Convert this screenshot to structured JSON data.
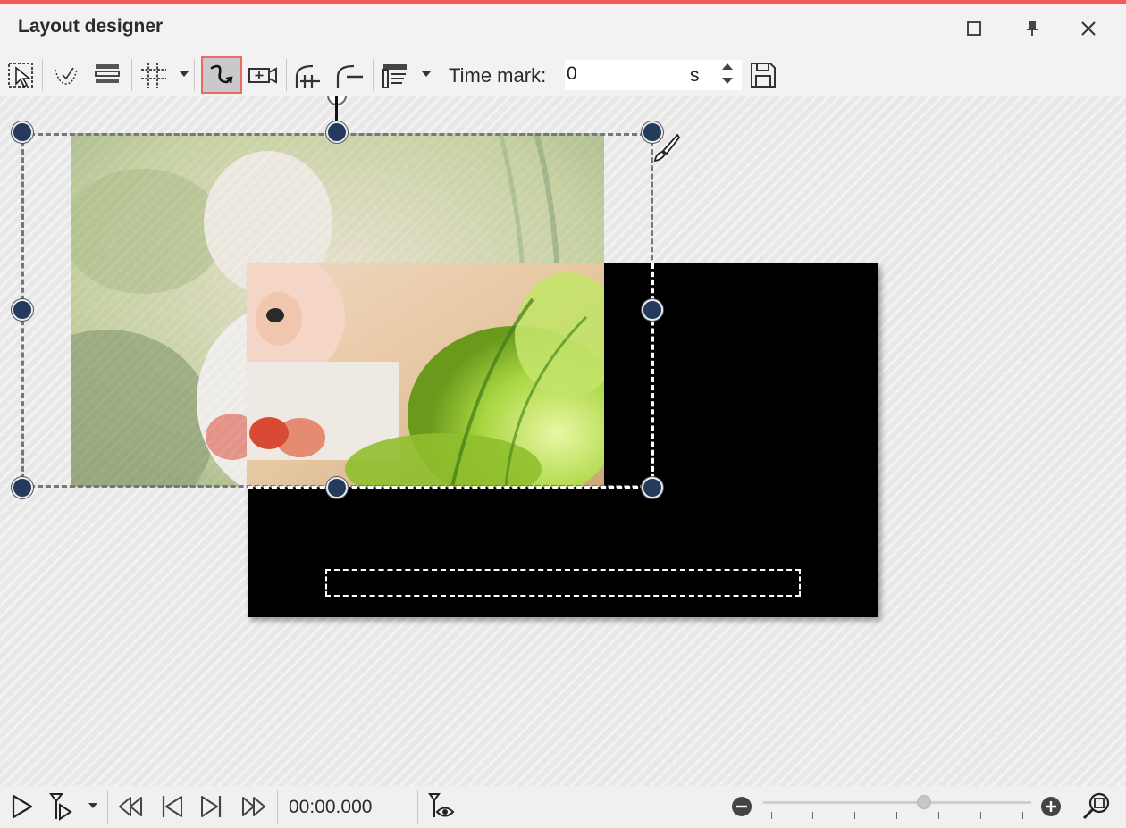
{
  "window": {
    "title": "Layout designer",
    "accent_color": "#f45b56",
    "buttons": [
      "maximize-icon",
      "pin-icon",
      "close-icon"
    ]
  },
  "toolbar": {
    "tools": [
      "select-region-icon",
      "curve-path-icon",
      "layers-icon",
      "grid-icon",
      "motion-path-icon",
      "camera-icon",
      "add-keyframe-icon",
      "remove-keyframe-icon",
      "align-icon"
    ],
    "active_tool": "motion-path-icon",
    "time_mark": {
      "label": "Time mark:",
      "value": "0",
      "unit": "s"
    },
    "save_icon": "save-icon"
  },
  "canvas": {
    "background": "striped-gray",
    "frame_color": "#000000",
    "handle_color": "#263a5c",
    "photo_description_hidden": true
  },
  "playback": {
    "timecode": "00:00.000",
    "controls": [
      "play-icon",
      "play-from-marker-icon",
      "rewind-icon",
      "previous-frame-icon",
      "next-frame-icon",
      "fast-forward-icon",
      "preview-eye-icon"
    ],
    "zoom": {
      "level_fraction": 0.6,
      "min_icon": "zoom-out-icon",
      "max_icon": "zoom-in-icon",
      "fit_icon": "zoom-fit-icon"
    }
  }
}
